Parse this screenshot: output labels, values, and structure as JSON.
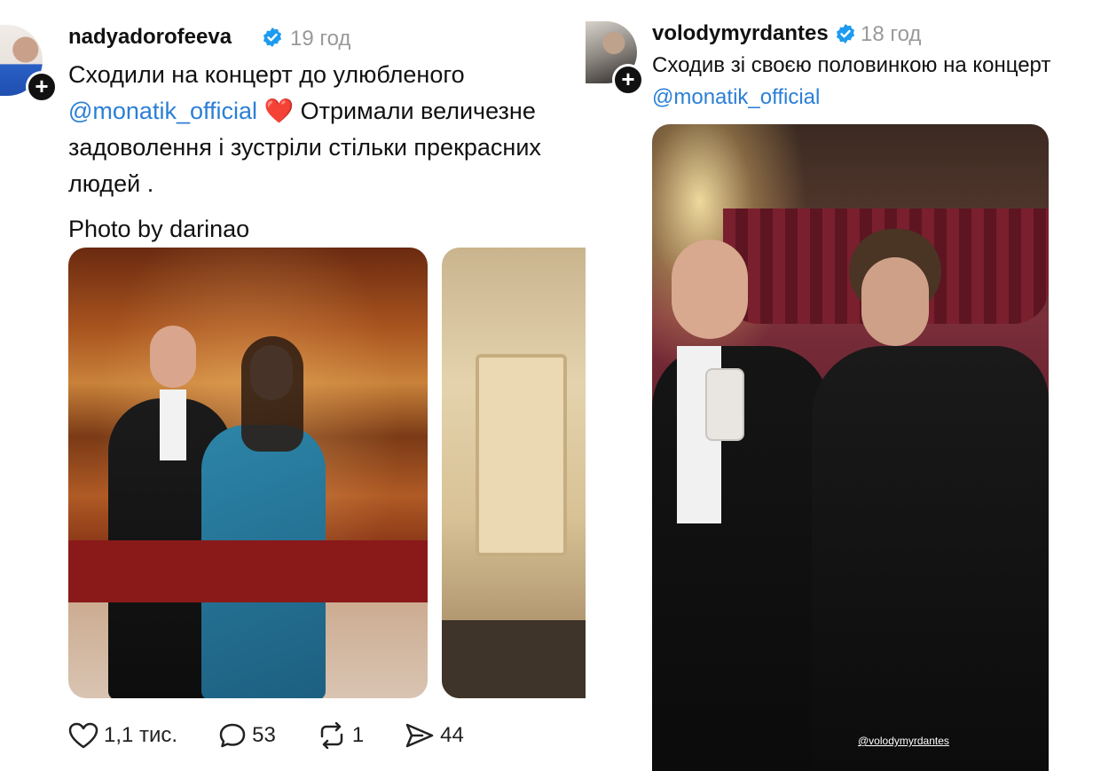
{
  "left_post": {
    "username": "nadyadorofeeva",
    "time": "19 год",
    "text_line1": "Сходили на концерт до улюбленого",
    "mention": "@monatik_official",
    "heart": "❤️",
    "text_line2_rest": "Отримали величезне",
    "text_line3": "задоволення і зустріли стільки прекрасних",
    "text_line4": "людей .",
    "photo_credit": "Photo by darinao",
    "likes": "1,1 тис.",
    "comments": "53",
    "reposts": "1",
    "shares": "44"
  },
  "right_post": {
    "username": "volodymyrdantes",
    "time": "18 год",
    "text_line1": "Сходив зі своєю половинкою на концерт",
    "mention": "@monatik_official",
    "story_watermark": "@volodymyrdantes"
  },
  "colors": {
    "link": "#2b7fd6",
    "verified": "#1d9bf0",
    "muted": "#999999"
  },
  "icons": [
    "plus-icon",
    "verified-badge-icon",
    "heart-icon",
    "comment-icon",
    "repost-icon",
    "share-icon"
  ]
}
